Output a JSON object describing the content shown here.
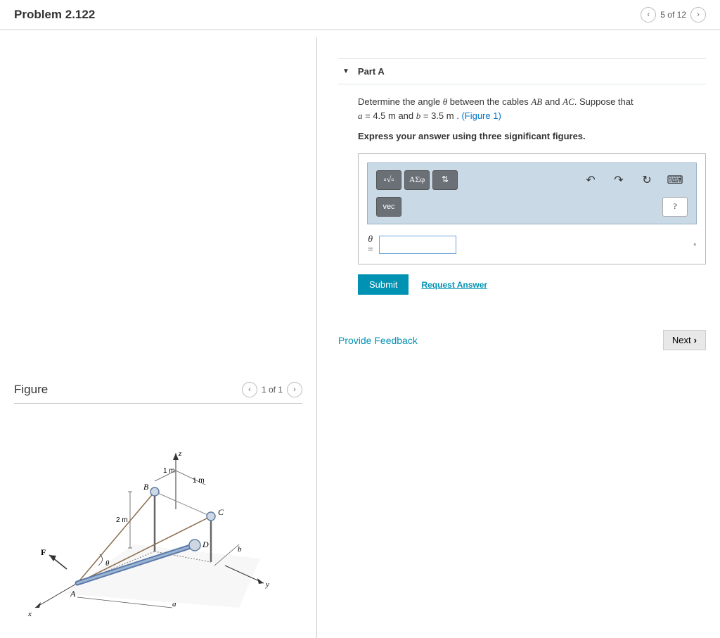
{
  "header": {
    "title": "Problem 2.122",
    "page_indicator": "5 of 12"
  },
  "left": {
    "figure_title": "Figure",
    "figure_page": "1 of 1",
    "labels": {
      "z": "z",
      "x": "x",
      "y": "y",
      "A": "A",
      "B": "B",
      "C": "C",
      "D": "D",
      "F": "F",
      "theta": "θ",
      "a": "a",
      "b": "b",
      "d1": "1 m",
      "d2": "1 m",
      "d3": "2 m"
    }
  },
  "part": {
    "title": "Part A",
    "prompt_pre": "Determine the angle ",
    "theta": "θ",
    "prompt_mid1": " between the cables ",
    "AB": "AB",
    "and": " and ",
    "AC": "AC",
    "prompt_mid2": ". Suppose that ",
    "a_var": "a",
    "a_val": " = 4.5  m ",
    "and2": "and ",
    "b_var": "b",
    "b_val": " = 3.5  m . ",
    "fig_link": "(Figure 1)",
    "instruct": "Express your answer using three significant figures.",
    "toolbar": {
      "templates": "▫√▫",
      "greek": "ΑΣφ",
      "arrows": "⇅",
      "undo": "↶",
      "redo": "↷",
      "reset": "↻",
      "keyboard": "⌨",
      "vec": "vec",
      "help": "?"
    },
    "answer": {
      "var": "θ",
      "eq": "=",
      "unit": "∘"
    },
    "submit": "Submit",
    "request": "Request Answer"
  },
  "footer": {
    "feedback": "Provide Feedback",
    "next": "Next"
  }
}
